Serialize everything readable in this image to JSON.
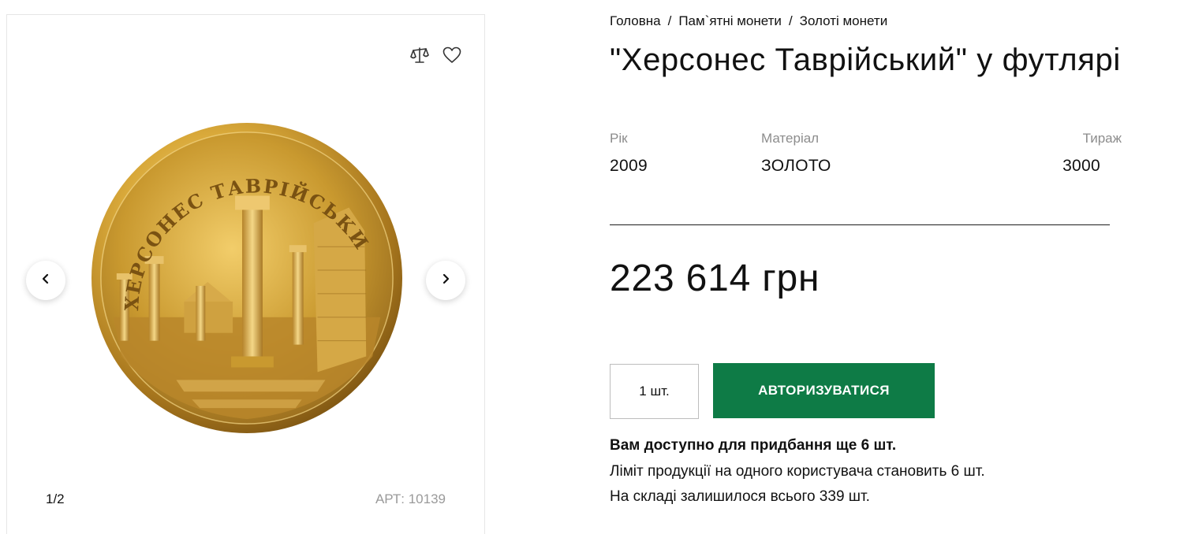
{
  "gallery": {
    "counter": "1/2",
    "sku": "АРТ: 10139",
    "coin_inscription": "ХЕРСОНЕС ТАВРІЙСЬКИЙ",
    "icons": {
      "compare": "scales-icon",
      "favorite": "heart-icon",
      "prev": "chevron-left-icon",
      "next": "chevron-right-icon"
    }
  },
  "breadcrumb": {
    "items": [
      "Головна",
      "Пам`ятні монети",
      "Золоті монети"
    ],
    "separator": "/"
  },
  "product": {
    "title": "\"Херсонес Таврійський\" у футлярі",
    "specs": [
      {
        "label": "Рік",
        "value": "2009"
      },
      {
        "label": "Матеріал",
        "value": "ЗОЛОТО"
      },
      {
        "label": "Тираж",
        "value": "3000"
      }
    ],
    "price": "223 614 грн",
    "quantity": "1 шт.",
    "button_label": "АВТОРИЗУВАТИСЯ",
    "notes": {
      "available": "Вам доступно для придбання ще 6 шт.",
      "limit": "Ліміт продукції на одного користувача становить 6 шт.",
      "stock": "На складі залишилося всього 339 шт."
    }
  },
  "colors": {
    "accent": "#0e7b46",
    "gold": "#c9992f",
    "muted_text": "#8c8c8c"
  }
}
